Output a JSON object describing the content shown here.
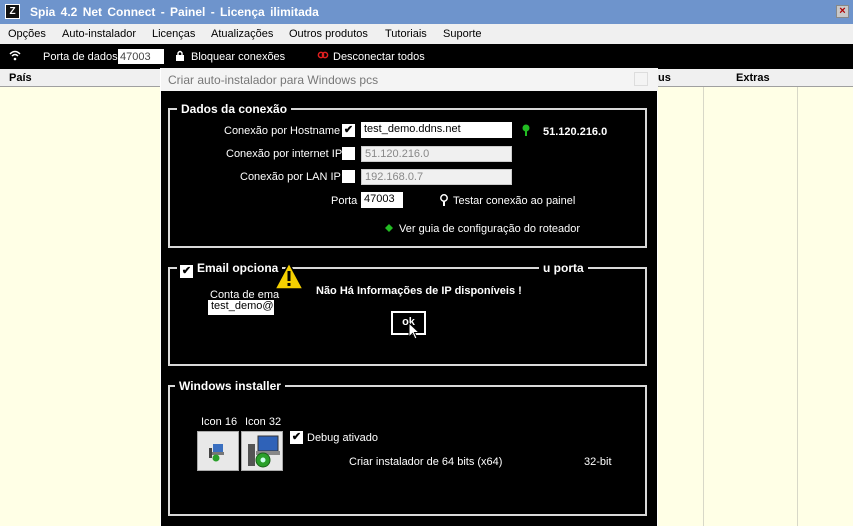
{
  "window": {
    "icon": "Z",
    "title": "Spia 4.2 Net Connect   -   Painel   -   Licença ilimitada",
    "close": "×"
  },
  "menu": [
    "Opções",
    "Auto-instalador",
    "Licenças",
    "Atualizações",
    "Outros produtos",
    "Tutoriais",
    "Suporte"
  ],
  "toolbar": {
    "port_label": "Porta de dados:",
    "port_value": "47003",
    "block_label": "Bloquear conexões",
    "disconnect_label": "Desconectar todos"
  },
  "table": {
    "col_pais": "País",
    "col_status_partial": "us",
    "col_extras": "Extras"
  },
  "dialog": {
    "title": "Criar auto-instalador para Windows pcs",
    "connection": {
      "legend": "Dados da conexão",
      "hostname_label": "Conexão por Hostname",
      "hostname_checked": "✔",
      "hostname_value": "test_demo.ddns.net",
      "hostname_ip": "51.120.216.0",
      "internet_label": "Conexão por internet IP",
      "internet_value": "51.120.216.0",
      "lan_label": "Conexão por LAN IP",
      "lan_value": "192.168.0.7",
      "port_label": "Porta",
      "port_value": "47003",
      "test_label": "Testar conexão ao painel",
      "guide_label": "Ver guia de configuração do roteador"
    },
    "email": {
      "legend_left": "Email opciona",
      "legend_right": "u porta",
      "checked": "✔",
      "account_label": "Conta de ema",
      "account_value": "test_demo@"
    },
    "installer": {
      "legend": "Windows installer",
      "icon16_label": "Icon 16",
      "icon32_label": "Icon 32",
      "debug_checked": "✔",
      "debug_label": "Debug ativado",
      "build_label": "Criar instalador de 64 bits  (x64)",
      "arch_label": "32-bit"
    }
  },
  "alert": {
    "message": "Não Há Informações de IP disponíveis !",
    "ok_label": "ok"
  },
  "colors": {
    "title_bar": "#6e94cc",
    "table_bg": "#ffffe6",
    "dialog_bg": "#000000",
    "status_green": "#22bb22",
    "warning_yellow": "#f5d000"
  }
}
